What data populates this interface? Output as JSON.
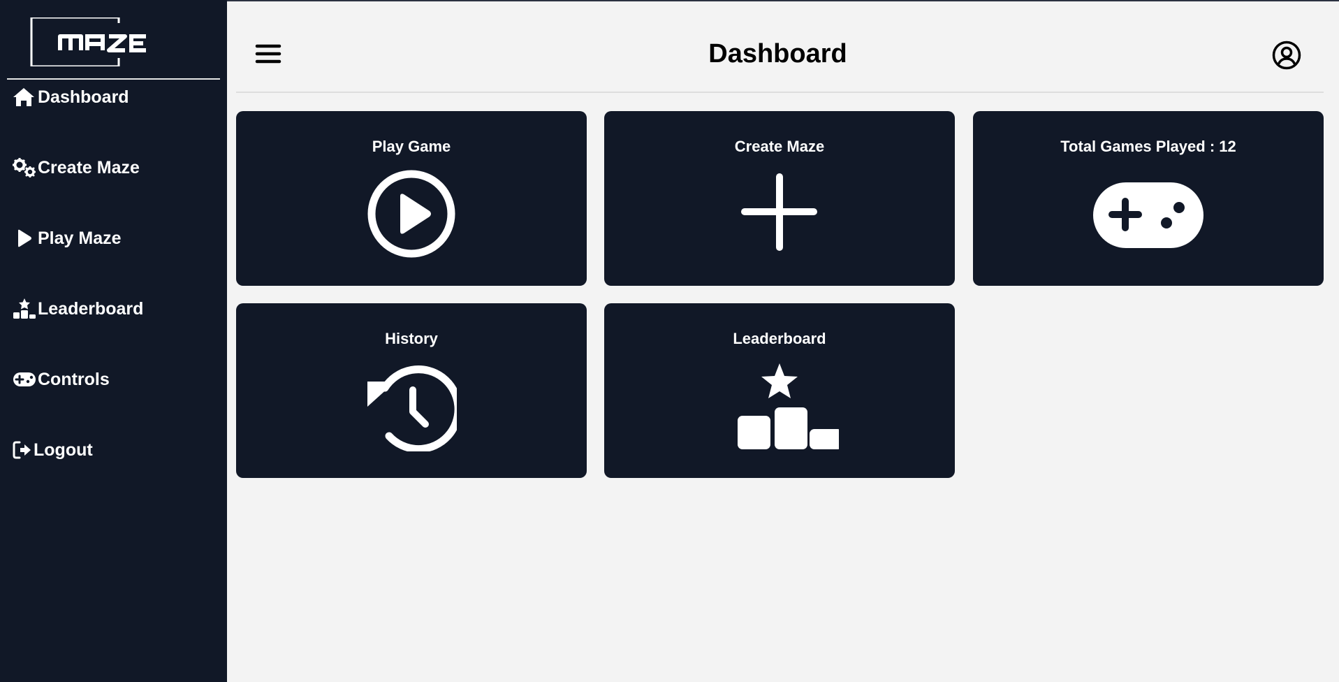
{
  "app": {
    "logo_text": "MAZE"
  },
  "colors": {
    "sidebar_bg": "#111827",
    "card_bg": "#111827",
    "page_bg": "#f3f3f3",
    "text_light": "#ffffff",
    "text_dark": "#000000"
  },
  "sidebar": {
    "items": [
      {
        "label": "Dashboard",
        "icon": "home-icon"
      },
      {
        "label": "Create Maze",
        "icon": "gears-icon"
      },
      {
        "label": "Play Maze",
        "icon": "play-icon"
      },
      {
        "label": "Leaderboard",
        "icon": "ranking-star-icon"
      },
      {
        "label": "Controls",
        "icon": "gamepad-icon"
      },
      {
        "label": "Logout",
        "icon": "logout-icon"
      }
    ]
  },
  "header": {
    "title": "Dashboard",
    "menu_icon": "hamburger-icon",
    "profile_icon": "user-circle-icon"
  },
  "cards": [
    {
      "title": "Play Game",
      "icon": "play-circle-icon"
    },
    {
      "title": "Create Maze",
      "icon": "plus-icon"
    },
    {
      "title": "Total Games Played : 12",
      "icon": "gamepad-icon"
    },
    {
      "title": "History",
      "icon": "history-icon"
    },
    {
      "title": "Leaderboard",
      "icon": "podium-star-icon"
    }
  ]
}
